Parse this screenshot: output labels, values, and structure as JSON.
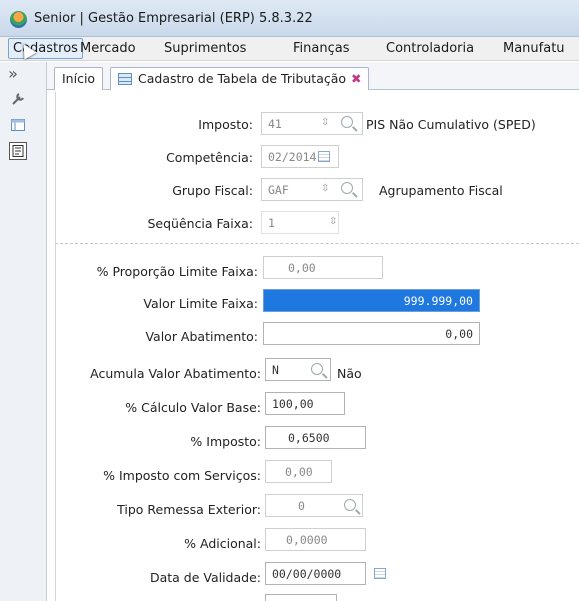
{
  "window": {
    "title": "Senior | Gestão Empresarial (ERP) 5.8.3.22"
  },
  "menu": [
    "Cadastros",
    "Mercado",
    "Suprimentos",
    "Finanças",
    "Controladoria",
    "Manufatu"
  ],
  "sidebar": {
    "collapse_glyph": "»",
    "icons": [
      "wrench-icon",
      "window-icon",
      "document-icon"
    ]
  },
  "tabs": [
    {
      "label": "Início"
    },
    {
      "label": "Cadastro de Tabela de Tributação",
      "close_glyph": "✖"
    }
  ],
  "form": {
    "imposto": {
      "label": "Imposto:",
      "value": "41",
      "desc": "PIS Não Cumulativo (SPED)"
    },
    "competencia": {
      "label": "Competência:",
      "value": "02/2014"
    },
    "grupo_fiscal": {
      "label": "Grupo Fiscal:",
      "value": "GAF",
      "desc": "Agrupamento Fiscal"
    },
    "sequencia_faixa": {
      "label": "Seqüência Faixa:",
      "value": "1"
    },
    "proporcao_limite": {
      "label": "% Proporção Limite Faixa:",
      "value": "0,00"
    },
    "valor_limite": {
      "label": "Valor Limite Faixa:",
      "value": "999.999,00"
    },
    "valor_abatimento": {
      "label": "Valor Abatimento:",
      "value": "0,00"
    },
    "acumula_abatimento": {
      "label": "Acumula Valor Abatimento:",
      "value": "N",
      "desc": "Não"
    },
    "calculo_valor_base": {
      "label": "% Cálculo Valor Base:",
      "value": "100,00"
    },
    "imposto_pct": {
      "label": "% Imposto:",
      "value": "0,6500"
    },
    "imposto_servicos": {
      "label": "% Imposto com Serviços:",
      "value": "0,00"
    },
    "tipo_remessa": {
      "label": "Tipo Remessa Exterior:",
      "value": "0"
    },
    "adicional": {
      "label": "% Adicional:",
      "value": "0,0000"
    },
    "data_validade": {
      "label": "Data de Validade:",
      "value": "00/00/0000"
    }
  },
  "glyphs": {
    "spinner": "⇳"
  }
}
